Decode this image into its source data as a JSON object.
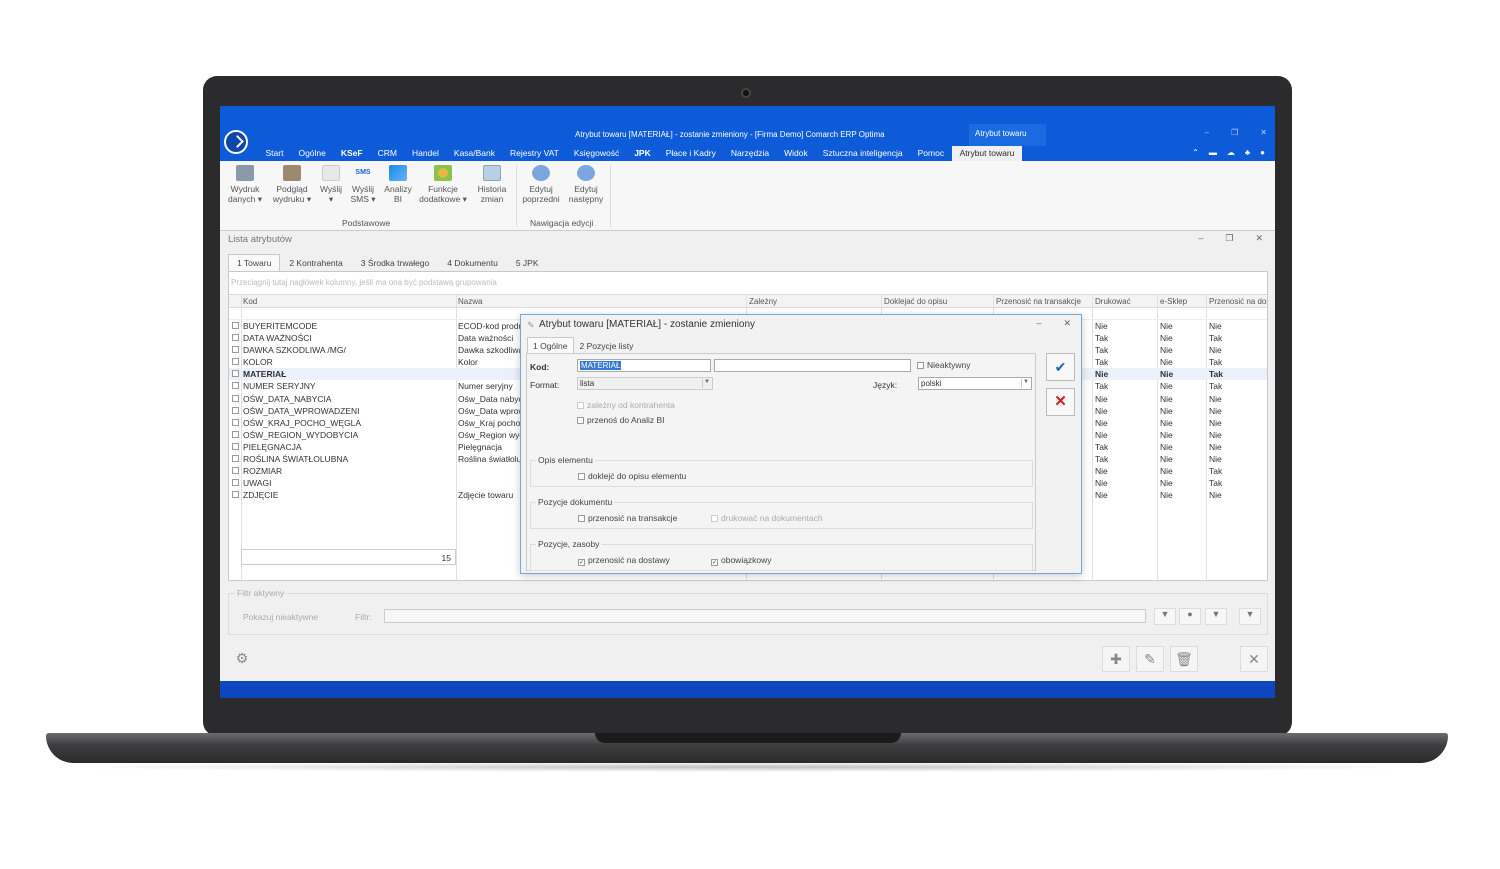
{
  "app": {
    "title": "Atrybut towaru [MATERIAŁ] - zostanie zmieniony - [Firma Demo] Comarch ERP Optima",
    "context_tab": "Atrybut towaru",
    "menu": [
      "Start",
      "Ogólne",
      "KSeF",
      "CRM",
      "Handel",
      "Kasa/Bank",
      "Rejestry VAT",
      "Księgowość",
      "JPK",
      "Płace i Kadry",
      "Narzędzia",
      "Widok",
      "Sztuczna inteligencja",
      "Pomoc",
      "Atrybut towaru"
    ],
    "accent": "#0d5bd8"
  },
  "ribbon": {
    "buttons": [
      {
        "l1": "Wydruk",
        "l2": "danych ▾",
        "icon": "printer-icon"
      },
      {
        "l1": "Podgląd",
        "l2": "wydruku ▾",
        "icon": "print-preview-icon"
      },
      {
        "l1": "Wyślij",
        "l2": "▾",
        "icon": "send-icon"
      },
      {
        "l1": "Wyślij",
        "l2": "SMS ▾",
        "icon": "sms-icon"
      },
      {
        "l1": "Analizy",
        "l2": "BI",
        "icon": "analytics-icon"
      },
      {
        "l1": "Funkcje",
        "l2": "dodatkowe ▾",
        "icon": "gears-icon"
      },
      {
        "l1": "Historia",
        "l2": "zmian",
        "icon": "history-icon"
      },
      {
        "l1": "Edytuj",
        "l2": "poprzedni",
        "icon": "prev-arrow-icon"
      },
      {
        "l1": "Edytuj",
        "l2": "następny",
        "icon": "next-arrow-icon"
      }
    ],
    "group_basic": "Podstawowe",
    "group_nav": "Nawigacja edycji",
    "sms_badge": "SMS"
  },
  "list": {
    "title": "Lista atrybutów",
    "tabs": [
      "1 Towaru",
      "2 Kontrahenta",
      "3 Środka trwałego",
      "4 Dokumentu",
      "5 JPK"
    ],
    "group_hint": "Przeciągnij tutaj nagłówek kolumny, jeśli ma ona być podstawą grupowania",
    "columns": [
      "Kod",
      "Nazwa",
      "Zależny",
      "Doklejać do opisu",
      "Przenosić na transakcje",
      "Drukować",
      "e-Sklep",
      "Przenosić na dostawy"
    ],
    "rows": [
      {
        "kod": "BUYERITEMCODE",
        "nazwa": "ECOD-kod produktu",
        "druk": "Nie",
        "esklep": "Nie",
        "dostawy": "Nie"
      },
      {
        "kod": "DATA WAŻNOŚCI",
        "nazwa": "Data ważności",
        "druk": "Tak",
        "esklep": "Nie",
        "dostawy": "Tak"
      },
      {
        "kod": "DAWKA SZKODLIWA /MG/",
        "nazwa": "Dawka szkodliwa",
        "druk": "Tak",
        "esklep": "Nie",
        "dostawy": "Nie"
      },
      {
        "kod": "KOLOR",
        "nazwa": "Kolor",
        "druk": "Tak",
        "esklep": "Nie",
        "dostawy": "Tak"
      },
      {
        "kod": "MATERIAŁ",
        "nazwa": "",
        "druk": "Nie",
        "esklep": "Nie",
        "dostawy": "Tak"
      },
      {
        "kod": "NUMER SERYJNY",
        "nazwa": "Numer seryjny",
        "druk": "Tak",
        "esklep": "Nie",
        "dostawy": "Tak"
      },
      {
        "kod": "OŚW_DATA_NABYCIA",
        "nazwa": "Ośw_Data nabycia",
        "druk": "Nie",
        "esklep": "Nie",
        "dostawy": "Nie"
      },
      {
        "kod": "OŚW_DATA_WPROWADZENI",
        "nazwa": "Ośw_Data wprowadzenia",
        "druk": "Nie",
        "esklep": "Nie",
        "dostawy": "Nie"
      },
      {
        "kod": "OŚW_KRAJ_POCHO_WĘGLA",
        "nazwa": "Ośw_Kraj pochodzenia",
        "druk": "Nie",
        "esklep": "Nie",
        "dostawy": "Nie"
      },
      {
        "kod": "OŚW_REGION_WYDOBYCIA",
        "nazwa": "Ośw_Region wydobycia",
        "druk": "Nie",
        "esklep": "Nie",
        "dostawy": "Nie"
      },
      {
        "kod": "PIELĘGNACJA",
        "nazwa": "Pielęgnacja",
        "druk": "Tak",
        "esklep": "Nie",
        "dostawy": "Nie"
      },
      {
        "kod": "ROŚLINA ŚWIATŁOLUBNA",
        "nazwa": "Roślina światłolubna",
        "druk": "Tak",
        "esklep": "Nie",
        "dostawy": "Nie"
      },
      {
        "kod": "ROZMIAR",
        "nazwa": "",
        "druk": "Nie",
        "esklep": "Nie",
        "dostawy": "Tak"
      },
      {
        "kod": "UWAGI",
        "nazwa": "",
        "druk": "Nie",
        "esklep": "Nie",
        "dostawy": "Tak"
      },
      {
        "kod": "ZDJĘCIE",
        "nazwa": "Zdjęcie towaru",
        "druk": "Nie",
        "esklep": "Nie",
        "dostawy": "Nie"
      }
    ],
    "count": "15",
    "filter_label": "Filtr aktywny",
    "show_inactive": "Pokazuj nieaktywne",
    "filter_field_label": "Filtr:"
  },
  "dialog": {
    "title": "Atrybut towaru [MATERIAŁ] - zostanie zmieniony",
    "tabs": [
      "1 Ogólne",
      "2 Pozycje listy"
    ],
    "kod_label": "Kod:",
    "kod_value": "MATERIAŁ",
    "inactive_label": "Nieaktywny",
    "format_label": "Format:",
    "format_value": "lista",
    "lang_label": "Język:",
    "lang_value": "polski",
    "depends_label": "zależny od kontrahenta",
    "bi_label": "przenoś do Analiz BI",
    "sec_opis": "Opis elementu",
    "opis_chk": "doklejć do opisu elementu",
    "sec_pozycje": "Pozycje dokumentu",
    "transakcje_chk": "przenosić na transakcje",
    "drukowac_chk": "drukować na dokumentach",
    "sec_zasoby": "Pozycje, zasoby",
    "dostawy_chk": "przenosić na dostawy",
    "obowiazkowy_chk": "obowiązkowy"
  }
}
